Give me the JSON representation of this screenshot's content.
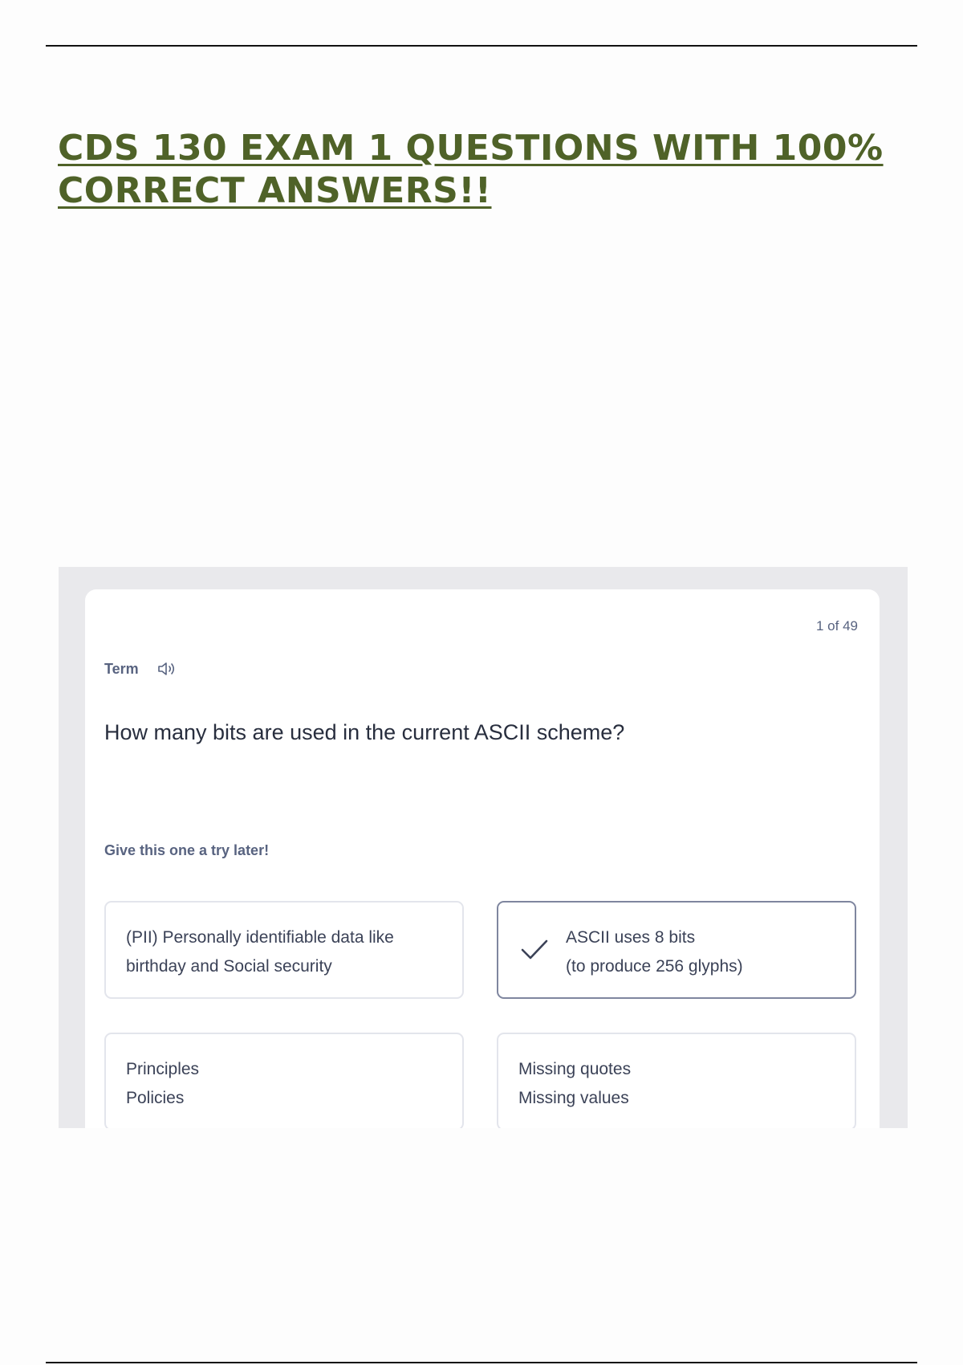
{
  "document": {
    "title_line1": "CDS 130 EXAM 1 QUESTIONS WITH 100%",
    "title_line2": "CORRECT ANSWERS!!"
  },
  "flashcard": {
    "counter": "1 of 49",
    "term_label": "Term",
    "audio_icon": "speaker-icon",
    "question": "How many bits are used in the current ASCII scheme?",
    "hint": "Give this one a try later!",
    "options": [
      {
        "line1": "(PII) Personally identifiable data like",
        "line2": "birthday and Social security",
        "selected": false
      },
      {
        "line1": "ASCII uses 8 bits",
        "line2": "(to produce 256 glyphs)",
        "selected": true,
        "icon": "check-icon"
      },
      {
        "line1": "Principles",
        "line2": "Policies",
        "selected": false
      },
      {
        "line1": "Missing quotes",
        "line2": "Missing values",
        "selected": false
      }
    ]
  },
  "colors": {
    "title": "#4f6228",
    "frame_background": "#e9e9ec",
    "muted_text": "#586380",
    "question_text": "#282e3e",
    "selected_border": "#7f869f"
  }
}
